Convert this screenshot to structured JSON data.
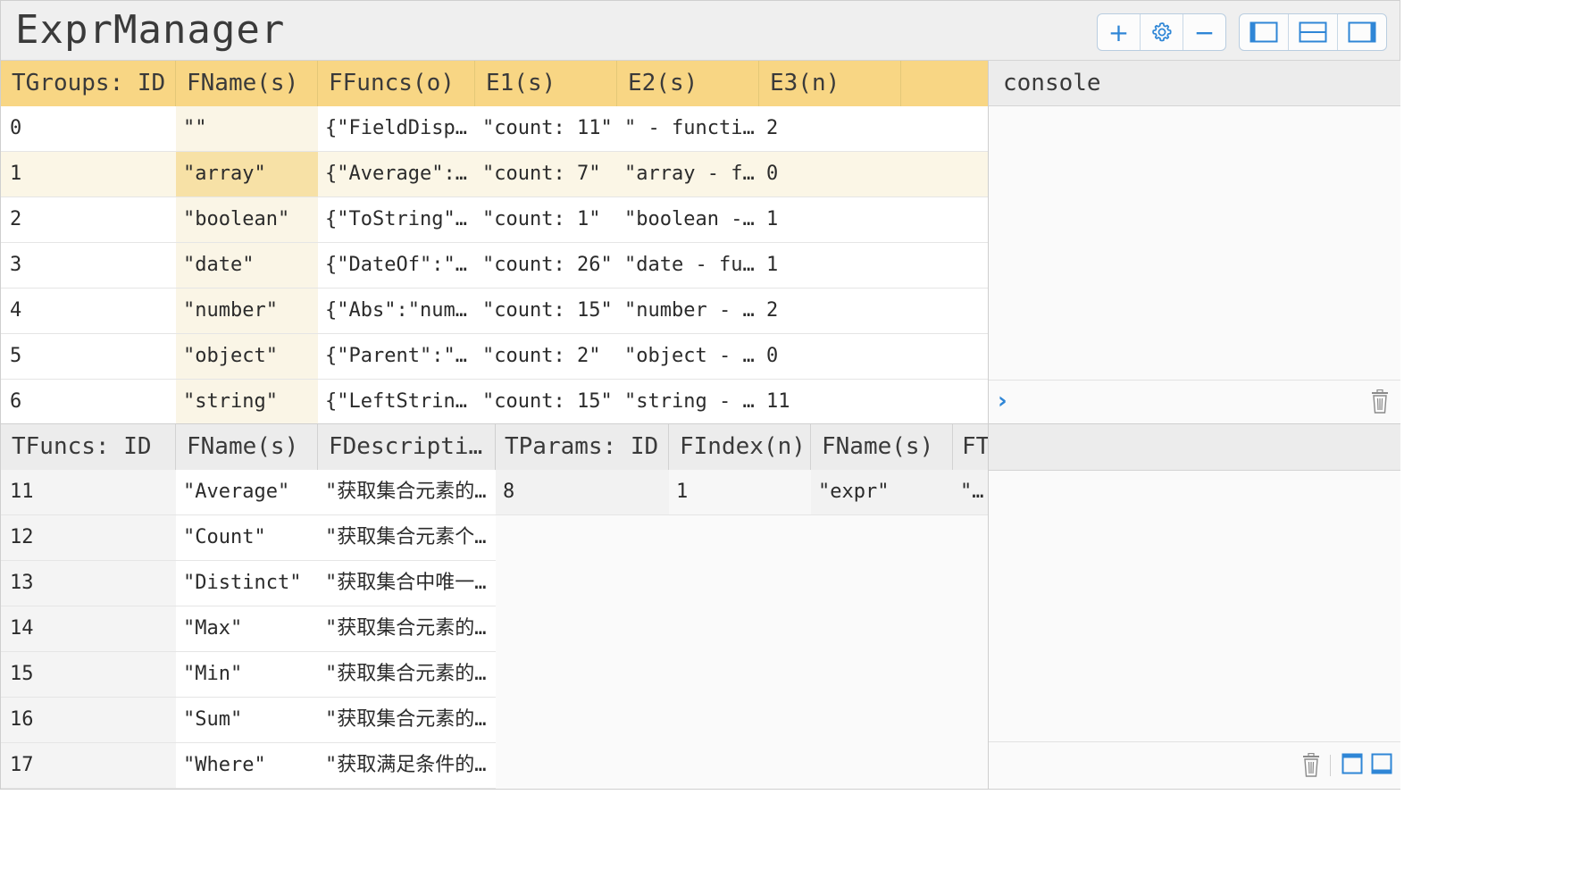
{
  "app": {
    "title": "ExprManager"
  },
  "toolbar": {
    "add_label": "+",
    "remove_label": "−",
    "icons": [
      "plus-icon",
      "gear-icon",
      "minus-icon",
      "panel-left-icon",
      "panel-bottom-icon",
      "panel-right-icon"
    ],
    "accent": "#2f86d6"
  },
  "groups": {
    "columns": [
      "TGroups: ID",
      "FName(s)",
      "FFuncs(o)",
      "E1(s)",
      "E2(s)",
      "E3(n)",
      ""
    ],
    "rows": [
      [
        "0",
        "\"\"",
        "{\"FieldDisp…",
        "\"count: 11\"",
        "\" - functi…",
        "2"
      ],
      [
        "1",
        "\"array\"",
        "{\"Average\":…",
        "\"count: 7\"",
        "\"array - f…",
        "0"
      ],
      [
        "2",
        "\"boolean\"",
        "{\"ToString\"…",
        "\"count: 1\"",
        "\"boolean -…",
        "1"
      ],
      [
        "3",
        "\"date\"",
        "{\"DateOf\":\"…",
        "\"count: 26\"",
        "\"date - fu…",
        "1"
      ],
      [
        "4",
        "\"number\"",
        "{\"Abs\":\"num…",
        "\"count: 15\"",
        "\"number - …",
        "2"
      ],
      [
        "5",
        "\"object\"",
        "{\"Parent\":\"…",
        "\"count: 2\"",
        "\"object - …",
        "0"
      ],
      [
        "6",
        "\"string\"",
        "{\"LeftStrin…",
        "\"count: 15\"",
        "\"string - …",
        "11"
      ]
    ],
    "selected_index": 1,
    "header_color": "#f8d684"
  },
  "console": {
    "title": "console",
    "prompt": "›"
  },
  "funcs": {
    "columns": [
      "TFuncs: ID",
      "FName(s)",
      "FDescriptio…"
    ],
    "rows": [
      [
        "11",
        "\"Average\"",
        "\"获取集合元素的平…"
      ],
      [
        "12",
        "\"Count\"",
        "\"获取集合元素个数\""
      ],
      [
        "13",
        "\"Distinct\"",
        "\"获取集合中唯一元…"
      ],
      [
        "14",
        "\"Max\"",
        "\"获取集合元素的最…"
      ],
      [
        "15",
        "\"Min\"",
        "\"获取集合元素的最…"
      ],
      [
        "16",
        "\"Sum\"",
        "\"获取集合元素的合…"
      ],
      [
        "17",
        "\"Where\"",
        "\"获取满足条件的元…"
      ]
    ]
  },
  "params": {
    "columns": [
      "TParams: ID",
      "FIndex(n)",
      "FName(s)",
      "FT"
    ],
    "rows": [
      [
        "8",
        "1",
        "\"expr\"",
        "\"ex"
      ]
    ]
  }
}
